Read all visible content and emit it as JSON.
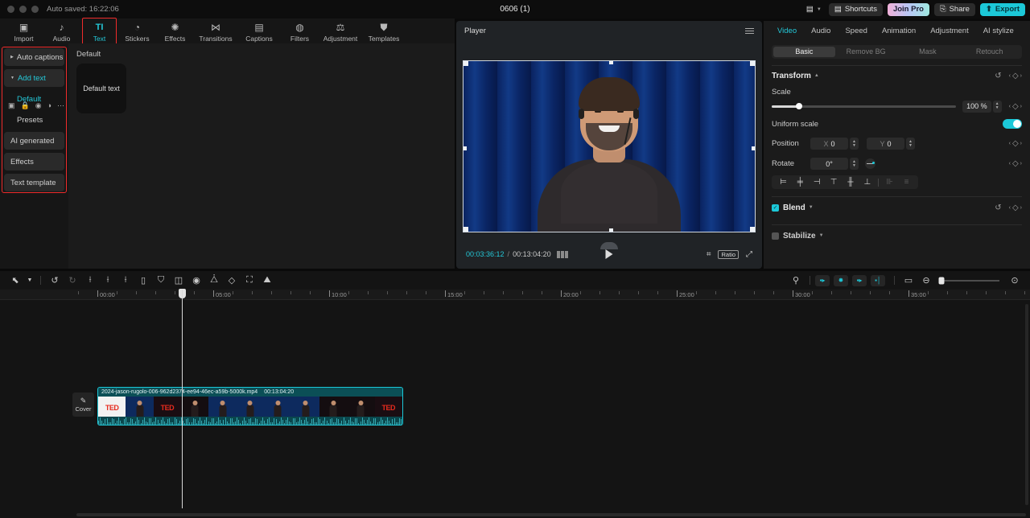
{
  "titlebar": {
    "autosave": "Auto saved: 16:22:06",
    "project_title": "0606 (1)",
    "layout_icon": "layout-icon",
    "caret_icon": "chevron-down-icon",
    "shortcuts_label": "Shortcuts",
    "shortcuts_icon": "keyboard-icon",
    "join_pro_label": "Join Pro",
    "share_label": "Share",
    "share_icon": "share-icon",
    "export_label": "Export",
    "export_icon": "upload-icon",
    "accent": "#1cc8d8",
    "highlight_red": "#ef2b2b"
  },
  "tabbar": {
    "tabs": [
      {
        "label": "Import",
        "icon": "import-icon",
        "glyph": "▣",
        "active": false
      },
      {
        "label": "Audio",
        "icon": "audio-icon",
        "glyph": "♪",
        "active": false
      },
      {
        "label": "Text",
        "icon": "text-icon",
        "glyph": "TI",
        "active": true
      },
      {
        "label": "Stickers",
        "icon": "stickers-icon",
        "glyph": "◔",
        "active": false
      },
      {
        "label": "Effects",
        "icon": "effects-icon",
        "glyph": "✺",
        "active": false
      },
      {
        "label": "Transitions",
        "icon": "transitions-icon",
        "glyph": "⋈",
        "active": false
      },
      {
        "label": "Captions",
        "icon": "captions-icon",
        "glyph": "▤",
        "active": false
      },
      {
        "label": "Filters",
        "icon": "filters-icon",
        "glyph": "◍",
        "active": false
      },
      {
        "label": "Adjustment",
        "icon": "adjustment-icon",
        "glyph": "⚖",
        "active": false
      },
      {
        "label": "Templates",
        "icon": "templates-icon",
        "glyph": "⛊",
        "active": false
      }
    ]
  },
  "sidebar": {
    "items": [
      {
        "label": "Auto captions",
        "type": "group",
        "expanded": false
      },
      {
        "label": "Add text",
        "type": "group",
        "expanded": true
      },
      {
        "label": "Default",
        "type": "sub",
        "selected": true
      },
      {
        "label": "Presets",
        "type": "sub",
        "selected": false
      },
      {
        "label": "AI generated",
        "type": "group",
        "expanded": false
      },
      {
        "label": "Effects",
        "type": "group",
        "expanded": false
      },
      {
        "label": "Text template",
        "type": "group",
        "expanded": false
      }
    ]
  },
  "content": {
    "heading": "Default",
    "cards": [
      {
        "label": "Default text"
      }
    ]
  },
  "player": {
    "title": "Player",
    "menu_icon": "hamburger-icon",
    "current_time": "00:03:36:12",
    "total_time": "00:13:04:20",
    "separator": "/",
    "grid_icon": "grid-icon",
    "play_icon": "play-icon",
    "zoom_icon": "magnifier-icon",
    "ratio_label": "Ratio",
    "fullscreen_icon": "fullscreen-icon"
  },
  "rpanel": {
    "tabs": [
      {
        "label": "Video",
        "active": true
      },
      {
        "label": "Audio",
        "active": false
      },
      {
        "label": "Speed",
        "active": false
      },
      {
        "label": "Animation",
        "active": false
      },
      {
        "label": "Adjustment",
        "active": false
      },
      {
        "label": "AI stylize",
        "active": false
      }
    ],
    "subtabs": [
      {
        "label": "Basic",
        "active": true
      },
      {
        "label": "Remove BG",
        "active": false
      },
      {
        "label": "Mask",
        "active": false
      },
      {
        "label": "Retouch",
        "active": false
      }
    ],
    "transform": {
      "title": "Transform",
      "collapse_icon": "chevron-up-icon",
      "reset_icon": "reset-icon",
      "keyframe_icon": "keyframe-diamond-icon",
      "scale_label": "Scale",
      "scale_value": "100 %",
      "uniform_scale_label": "Uniform scale",
      "uniform_scale_on": true,
      "position_label": "Position",
      "position_x_label": "X",
      "position_x_value": "0",
      "position_y_label": "Y",
      "position_y_value": "0",
      "rotate_label": "Rotate",
      "rotate_value": "0°"
    },
    "align_buttons": [
      {
        "icon": "align-left-icon",
        "glyph": "⊨",
        "disabled": false
      },
      {
        "icon": "align-center-horizontal-icon",
        "glyph": "╪",
        "disabled": false
      },
      {
        "icon": "align-right-icon",
        "glyph": "⊣",
        "disabled": false
      },
      {
        "icon": "align-top-icon",
        "glyph": "⊤",
        "disabled": false
      },
      {
        "icon": "align-middle-vertical-icon",
        "glyph": "╫",
        "disabled": false
      },
      {
        "icon": "align-bottom-icon",
        "glyph": "⊥",
        "disabled": false
      },
      {
        "icon": "distribute-horizontal-icon",
        "glyph": "⊪",
        "disabled": true
      },
      {
        "icon": "distribute-vertical-icon",
        "glyph": "≡",
        "disabled": true
      }
    ],
    "blend": {
      "label": "Blend",
      "checked": true,
      "collapse_icon": "chevron-down-icon"
    },
    "stabilize": {
      "label": "Stabilize",
      "checked": false,
      "collapse_icon": "chevron-down-icon"
    }
  },
  "timeline_toolbar": {
    "left_tools": [
      {
        "icon": "select-arrow-icon",
        "glyph": "⬉"
      },
      {
        "icon": "chevron-down-icon",
        "glyph": "⌄"
      },
      {
        "icon": "undo-icon",
        "glyph": "↺"
      },
      {
        "icon": "redo-icon",
        "glyph": "↻"
      },
      {
        "icon": "split-icon",
        "glyph": "⟊"
      },
      {
        "icon": "trim-left-icon",
        "glyph": "⟊"
      },
      {
        "icon": "trim-right-icon",
        "glyph": "⟊"
      },
      {
        "icon": "delete-icon",
        "glyph": "▯"
      },
      {
        "icon": "mask-icon",
        "glyph": "⛉"
      },
      {
        "icon": "crop-frame-icon",
        "glyph": "◫"
      },
      {
        "icon": "freeze-frame-icon",
        "glyph": "◉"
      },
      {
        "icon": "mirror-icon",
        "glyph": "⧊"
      },
      {
        "icon": "rotate-icon",
        "glyph": "◇"
      },
      {
        "icon": "crop-icon",
        "glyph": "⛶"
      },
      {
        "icon": "image-icon",
        "glyph": "⛰"
      }
    ],
    "right_tools": [
      {
        "icon": "microphone-icon",
        "glyph": "🎙",
        "chip": false
      },
      {
        "icon": "auto-cut-icon",
        "glyph": "▪▸",
        "chip": true
      },
      {
        "icon": "smart-cut-icon",
        "glyph": "✸",
        "chip": true
      },
      {
        "icon": "trim-gap-icon",
        "glyph": "▪▸",
        "chip": true
      },
      {
        "icon": "split-clip-icon",
        "glyph": "▪│",
        "chip": true
      },
      {
        "icon": "render-preview-icon",
        "glyph": "▭",
        "chip": false
      },
      {
        "icon": "zoom-out-icon",
        "glyph": "⊖",
        "chip": false
      },
      {
        "icon": "zoom-fit-icon",
        "glyph": "⊙",
        "chip": false
      }
    ]
  },
  "ruler": {
    "labels": [
      "00:00",
      "05:00",
      "10:00",
      "15:00",
      "20:00",
      "25:00",
      "30:00",
      "35:00"
    ],
    "positions": [
      121,
      265,
      409,
      553,
      697,
      841,
      985,
      1129
    ],
    "minor_spacing": 24
  },
  "track": {
    "head_icons": [
      {
        "icon": "track-type-icon",
        "glyph": "▣"
      },
      {
        "icon": "lock-icon",
        "glyph": "🔒"
      },
      {
        "icon": "eye-icon",
        "glyph": "◉"
      },
      {
        "icon": "mute-icon",
        "glyph": "🔈"
      },
      {
        "icon": "more-icon",
        "glyph": "⋯"
      }
    ],
    "cover_button": {
      "label": "Cover",
      "icon": "pencil-icon"
    }
  },
  "clip": {
    "name": "2024-jason-rugolo-006-962d2374-ee94-46ec-a59b-5000k.mp4",
    "duration": "00:13:04:20",
    "color": "#0d5b62",
    "border": "#1cc8d8",
    "thumbnails": [
      {
        "kind": "white",
        "ted": true
      },
      {
        "kind": "blue",
        "ted": false
      },
      {
        "kind": "red",
        "ted": true
      },
      {
        "kind": "dark",
        "ted": false
      },
      {
        "kind": "blue",
        "ted": false
      },
      {
        "kind": "blue",
        "ted": false
      },
      {
        "kind": "blue",
        "ted": false
      },
      {
        "kind": "blue",
        "ted": false
      },
      {
        "kind": "dark",
        "ted": false
      },
      {
        "kind": "dark",
        "ted": false
      },
      {
        "kind": "red",
        "ted": true
      }
    ]
  }
}
